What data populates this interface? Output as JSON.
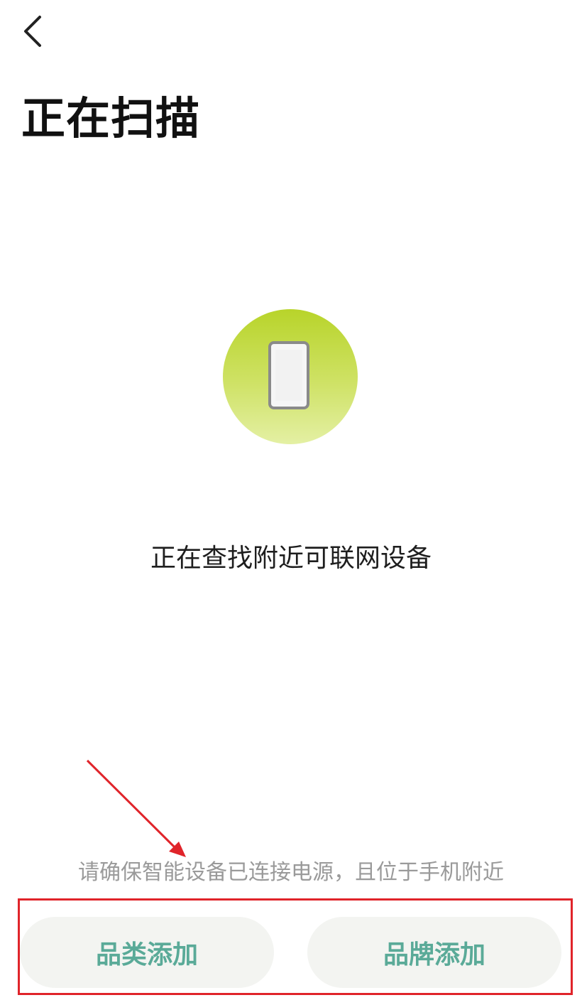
{
  "header": {
    "back_icon": "chevron-left-icon",
    "title": "正在扫描"
  },
  "scan": {
    "status_text": "正在查找附近可联网设备",
    "circle_gradient": [
      "#b8d42a",
      "#e4f0a4"
    ],
    "icon": "smartphone-icon"
  },
  "hint": {
    "text": "请确保智能设备已连接电源，且位于手机附近"
  },
  "actions": {
    "category_label": "品类添加",
    "brand_label": "品牌添加",
    "label_color": "#5aaa98"
  },
  "annotation": {
    "color": "#e0242a"
  }
}
